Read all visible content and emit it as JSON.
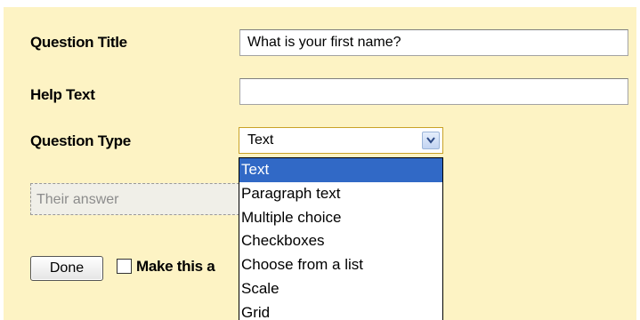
{
  "form": {
    "title_label": "Question Title",
    "title_value": "What is your first name?",
    "help_label": "Help Text",
    "help_value": "",
    "type_label": "Question Type",
    "type_selected": "Text",
    "answer_placeholder": "Their answer",
    "done_label": "Done",
    "required_label": "Make this a"
  },
  "dropdown": {
    "options": [
      {
        "label": "Text",
        "selected": true
      },
      {
        "label": "Paragraph text"
      },
      {
        "label": "Multiple choice"
      },
      {
        "label": "Checkboxes"
      },
      {
        "label": "Choose from a list"
      },
      {
        "label": "Scale"
      },
      {
        "label": "Grid"
      }
    ]
  },
  "colors": {
    "panel_background": "#fdf3c4",
    "selection_highlight": "#3169c6",
    "select_border": "#c9a227"
  }
}
